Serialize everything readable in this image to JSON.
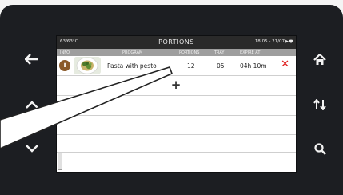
{
  "status_bar": {
    "temperature": "63/63°C",
    "title": "PORTIONS",
    "datetime": "18:05 - 21/07",
    "play_icon": "play-icon",
    "wifi_icon": "wifi-icon"
  },
  "table": {
    "columns": [
      "INFO",
      "PROGRAM",
      "PORTIONS",
      "TRAY",
      "EXPIRE AT"
    ],
    "rows": [
      {
        "program": "Pasta with pesto",
        "portions": "12",
        "tray": "05",
        "expire": "04h 10m",
        "info_label": "i",
        "delete_label": "✕"
      }
    ],
    "add_label": "+"
  },
  "side_buttons": {
    "back": "←",
    "up": "^",
    "down": "v",
    "home": "⌂",
    "sort": "⇅",
    "search": "⌕"
  },
  "colors": {
    "bezel": "#1c1e22",
    "delete": "#e02020",
    "info": "#8a5a2a"
  }
}
